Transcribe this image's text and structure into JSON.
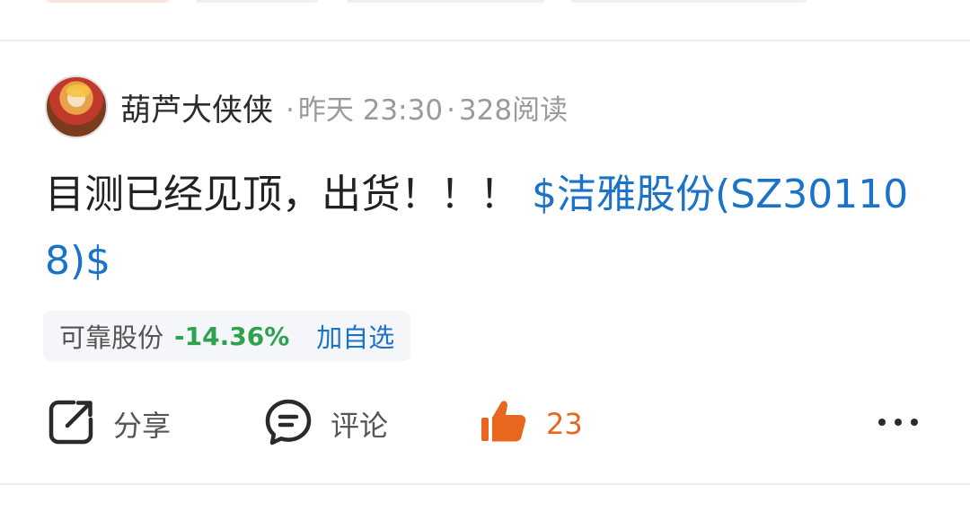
{
  "post": {
    "author": {
      "name": "葫芦大侠侠",
      "time": "昨天 23:30",
      "reads": "328阅读",
      "separator": "·"
    },
    "content": {
      "text": "目测已经见顶，出货！！！",
      "stock_link": "$洁雅股份(SZ301108)$"
    },
    "stock_chip": {
      "name": "可靠股份",
      "change": "-14.36%",
      "add_label": "加自选"
    },
    "actions": {
      "share_label": "分享",
      "comment_label": "评论",
      "like_count": "23"
    }
  },
  "colors": {
    "link": "#1a73c8",
    "down": "#2fa24e",
    "like": "#e8661e",
    "meta": "#9a9a9a"
  },
  "icons": {
    "share": "share-icon",
    "comment": "comment-icon",
    "like": "thumbs-up-icon",
    "more": "more-icon"
  }
}
